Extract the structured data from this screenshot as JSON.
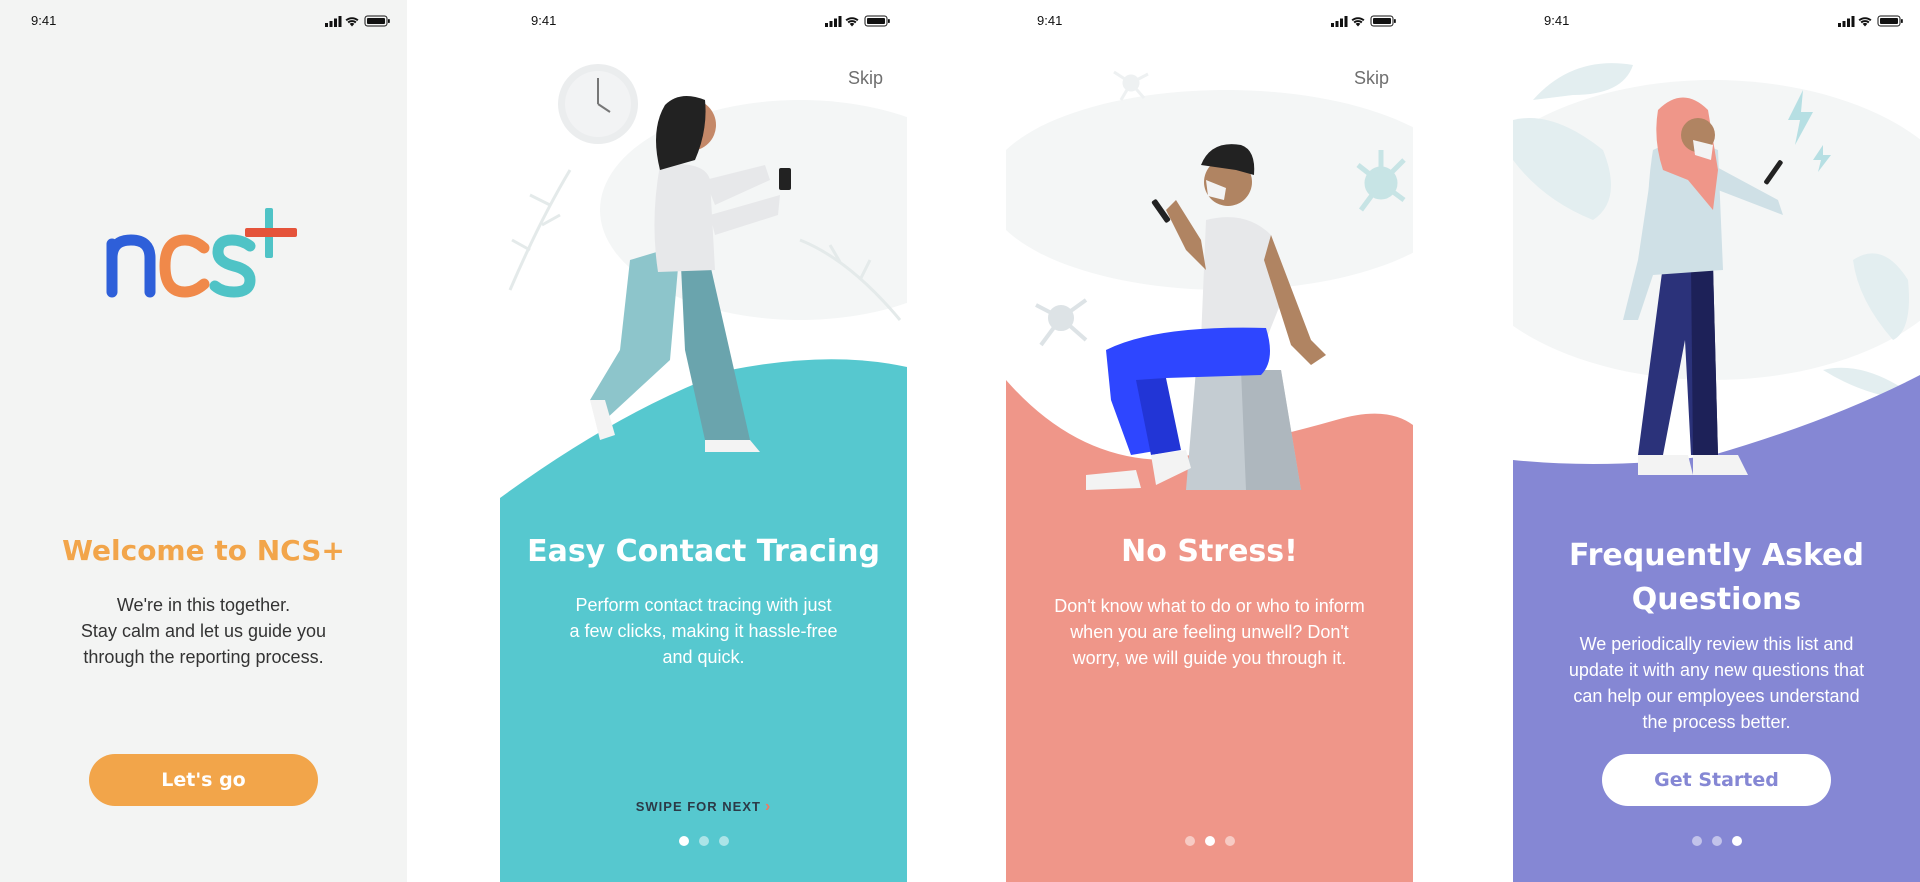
{
  "status_bar": {
    "time": "9:41"
  },
  "colors": {
    "orange": "#f2a54a",
    "teal": "#56c8cf",
    "coral": "#ef9689",
    "purple": "#8587d4",
    "logo_blue": "#2e5fd9",
    "logo_orange": "#f0894a",
    "logo_teal": "#4fc3c6",
    "logo_red": "#e5533a"
  },
  "screens": [
    {
      "logo_text": "ncs+",
      "title": "Welcome to NCS+",
      "desc_lines": [
        "We're in this together.",
        "Stay calm and let us guide you",
        "through the reporting process."
      ],
      "button_label": "Let's go"
    },
    {
      "skip_label": "Skip",
      "title": "Easy Contact Tracing",
      "desc_lines": [
        "Perform contact tracing with just",
        "a few clicks, making it hassle-free",
        "and quick."
      ],
      "swipe_label": "SWIPE FOR NEXT",
      "swipe_icon": "chevron-right-icon",
      "dots": {
        "total": 3,
        "active": 1
      }
    },
    {
      "skip_label": "Skip",
      "title": "No Stress!",
      "desc_lines": [
        "Don't know what to do or who to inform",
        "when you are feeling unwell? Don't",
        "worry, we will guide you through it."
      ],
      "dots": {
        "total": 3,
        "active": 2
      }
    },
    {
      "title_lines": [
        "Frequently Asked",
        "Questions"
      ],
      "desc_lines": [
        "We periodically review this list and",
        "update it with any new questions that",
        "can help our employees understand",
        "the process better."
      ],
      "button_label": "Get Started",
      "dots": {
        "total": 3,
        "active": 3
      }
    }
  ]
}
